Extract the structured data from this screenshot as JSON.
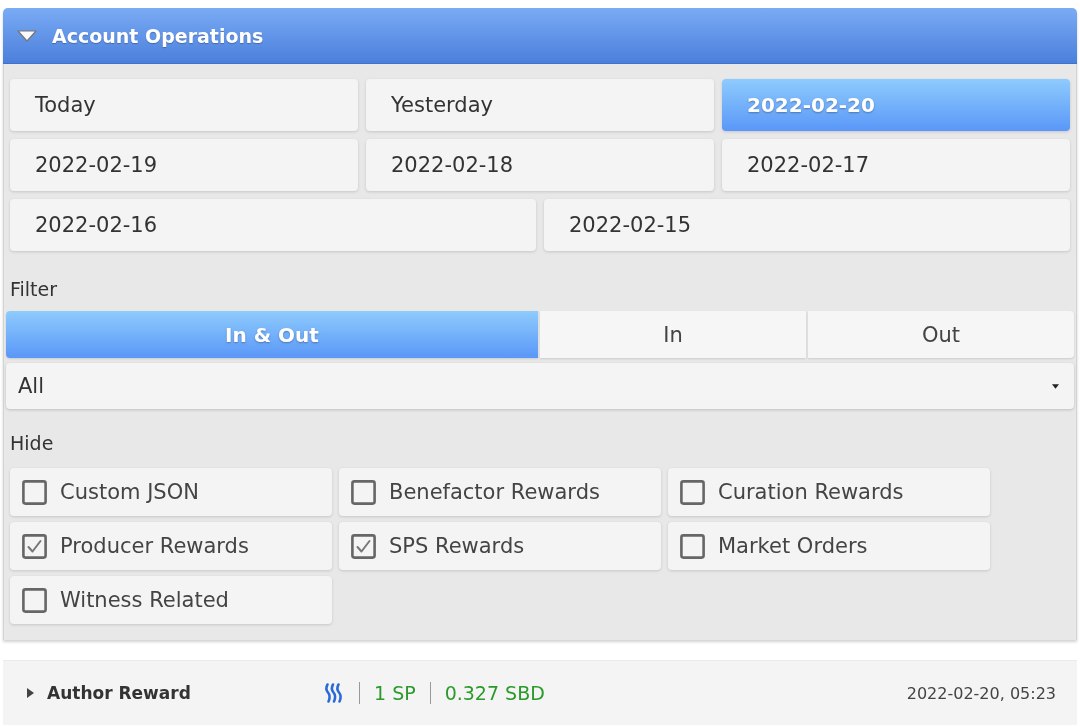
{
  "panel": {
    "title": "Account Operations",
    "expanded": true
  },
  "date_buttons": [
    {
      "label": "Today",
      "selected": false
    },
    {
      "label": "Yesterday",
      "selected": false
    },
    {
      "label": "2022-02-20",
      "selected": true
    },
    {
      "label": "2022-02-19",
      "selected": false
    },
    {
      "label": "2022-02-18",
      "selected": false
    },
    {
      "label": "2022-02-17",
      "selected": false
    },
    {
      "label": "2022-02-16",
      "selected": false
    },
    {
      "label": "2022-02-15",
      "selected": false
    }
  ],
  "filter": {
    "label": "Filter",
    "tabs": [
      {
        "label": "In & Out",
        "selected": true
      },
      {
        "label": "In",
        "selected": false
      },
      {
        "label": "Out",
        "selected": false
      }
    ],
    "select": {
      "value": "All"
    }
  },
  "hide": {
    "label": "Hide",
    "options": [
      {
        "label": "Custom JSON",
        "checked": false
      },
      {
        "label": "Benefactor Rewards",
        "checked": false
      },
      {
        "label": "Curation Rewards",
        "checked": false
      },
      {
        "label": "Producer Rewards",
        "checked": true
      },
      {
        "label": "SPS Rewards",
        "checked": true
      },
      {
        "label": "Market Orders",
        "checked": false
      },
      {
        "label": "Witness Related",
        "checked": false
      }
    ]
  },
  "operations": [
    {
      "type": "Author Reward",
      "expanded": false,
      "amounts": [
        "1 SP",
        "0.327 SBD"
      ],
      "time": "2022-02-20, 05:23"
    }
  ]
}
